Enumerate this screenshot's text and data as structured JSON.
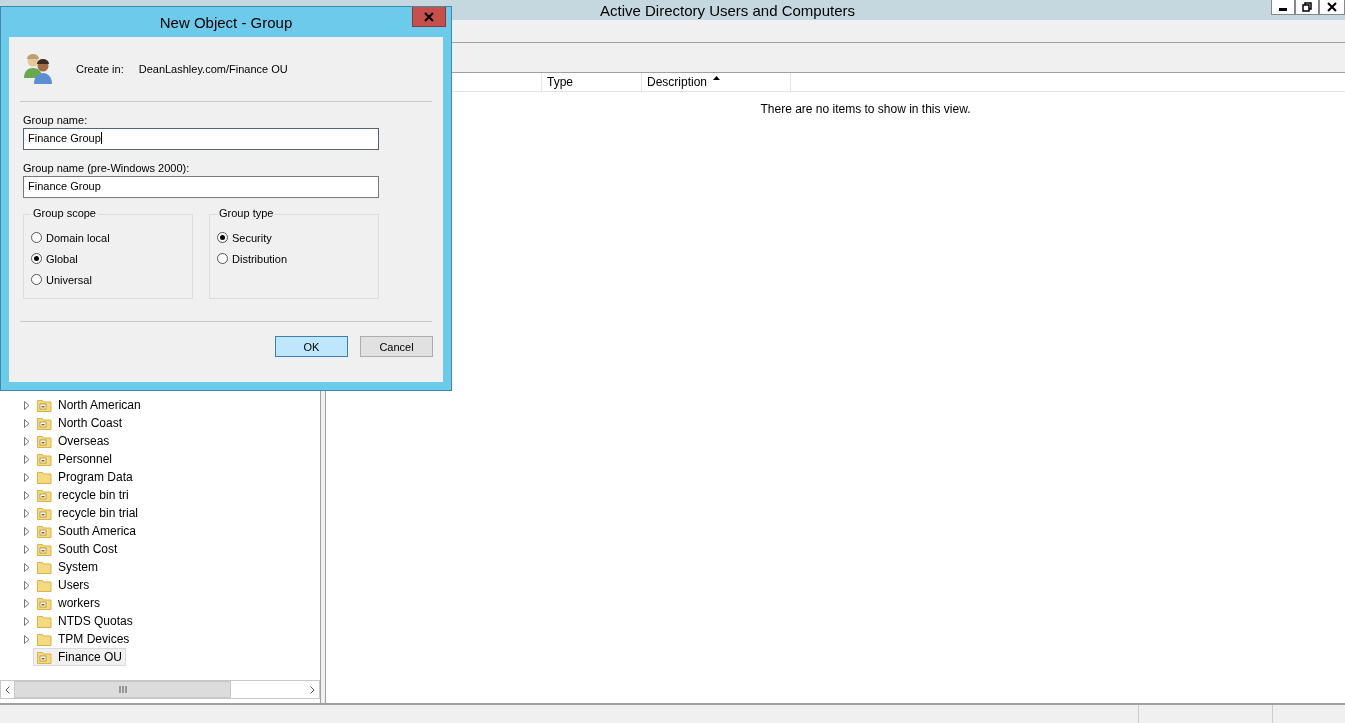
{
  "window": {
    "title": "Active Directory Users and Computers"
  },
  "tree": {
    "items": [
      {
        "label": "North American",
        "kind": "ou",
        "expandable": true,
        "selected": false
      },
      {
        "label": "North Coast",
        "kind": "ou",
        "expandable": true,
        "selected": false
      },
      {
        "label": "Overseas",
        "kind": "ou",
        "expandable": true,
        "selected": false
      },
      {
        "label": "Personnel",
        "kind": "ou",
        "expandable": true,
        "selected": false
      },
      {
        "label": "Program Data",
        "kind": "container",
        "expandable": true,
        "selected": false
      },
      {
        "label": "recycle bin tri",
        "kind": "ou",
        "expandable": true,
        "selected": false
      },
      {
        "label": "recycle bin trial",
        "kind": "ou",
        "expandable": true,
        "selected": false
      },
      {
        "label": "South America",
        "kind": "ou",
        "expandable": true,
        "selected": false
      },
      {
        "label": "South Cost",
        "kind": "ou",
        "expandable": true,
        "selected": false
      },
      {
        "label": "System",
        "kind": "container",
        "expandable": true,
        "selected": false
      },
      {
        "label": "Users",
        "kind": "container",
        "expandable": true,
        "selected": false
      },
      {
        "label": "workers",
        "kind": "ou",
        "expandable": true,
        "selected": false
      },
      {
        "label": "NTDS Quotas",
        "kind": "container",
        "expandable": true,
        "selected": false
      },
      {
        "label": "TPM Devices",
        "kind": "container",
        "expandable": true,
        "selected": false
      },
      {
        "label": "Finance OU",
        "kind": "ou",
        "expandable": false,
        "selected": true
      }
    ]
  },
  "list_view": {
    "columns": [
      {
        "label": "Type",
        "sorted": false
      },
      {
        "label": "Description",
        "sorted": true
      }
    ],
    "empty_message": "There are no items to show in this view."
  },
  "dialog": {
    "title": "New Object - Group",
    "create_in_label": "Create in:",
    "create_in_path": "DeanLashley.com/Finance OU",
    "fields": [
      {
        "label": "Group name:",
        "value": "Finance Group",
        "focused": true
      },
      {
        "label": "Group name (pre-Windows 2000):",
        "value": "Finance Group",
        "focused": false
      }
    ],
    "groups": [
      {
        "title": "Group scope",
        "options": [
          {
            "label": "Domain local",
            "selected": false
          },
          {
            "label": "Global",
            "selected": true
          },
          {
            "label": "Universal",
            "selected": false
          }
        ]
      },
      {
        "title": "Group type",
        "options": [
          {
            "label": "Security",
            "selected": true
          },
          {
            "label": "Distribution",
            "selected": false
          }
        ]
      }
    ],
    "buttons": [
      {
        "label": "OK",
        "default": true
      },
      {
        "label": "Cancel",
        "default": false
      }
    ]
  }
}
